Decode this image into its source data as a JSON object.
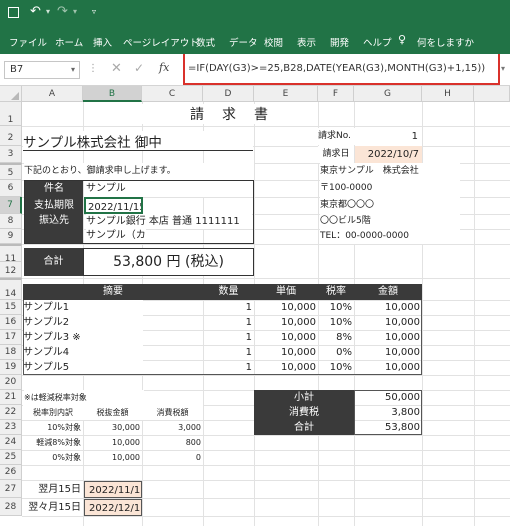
{
  "menu": [
    "ファイル",
    "ホーム",
    "挿入",
    "ページレイアウト",
    "数式",
    "データ",
    "校閲",
    "表示",
    "開発",
    "ヘルプ",
    "何をしますか"
  ],
  "formula_bar": {
    "name_box": "B7",
    "fx": "fx",
    "formula": "=IF(DAY(G3)>=25,B28,DATE(YEAR(G3),MONTH(G3)+1,15))"
  },
  "columns": [
    "A",
    "B",
    "C",
    "D",
    "E",
    "F",
    "G",
    "H"
  ],
  "rows": [
    "1",
    "2",
    "3",
    "5",
    "6",
    "7",
    "8",
    "9",
    "11",
    "12",
    "14",
    "15",
    "16",
    "17",
    "18",
    "19",
    "20",
    "21",
    "22",
    "23",
    "24",
    "25",
    "26",
    "27",
    "28"
  ],
  "sheet": {
    "title": "請　求　書",
    "client": "サンプル株式会社 御中",
    "invoice_no_label": "請求No.",
    "invoice_no": "1",
    "invoice_date_label": "請求日",
    "invoice_date": "2022/10/7",
    "intro": "下記のとおり、御請求申し上げます。",
    "issuer": [
      "東京サンプル　株式会社",
      "〒100-0000",
      "東京都〇〇〇",
      "〇〇ビル5階",
      "TEL：00-0000-0000"
    ],
    "info_labels": [
      "件名",
      "支払期限",
      "振込先"
    ],
    "info_values": [
      "サンプル",
      "2022/11/15",
      "サンプル銀行 本店 普通 1111111",
      "サンプル（カ"
    ],
    "total_label": "合計",
    "total_value": "53,800 円 (税込)",
    "table_headers": [
      "摘要",
      "数量",
      "単価",
      "税率",
      "金額"
    ],
    "items": [
      {
        "name": "サンプル1",
        "qty": "1",
        "price": "10,000",
        "rate": "10%",
        "amount": "10,000"
      },
      {
        "name": "サンプル2",
        "qty": "1",
        "price": "10,000",
        "rate": "10%",
        "amount": "10,000"
      },
      {
        "name": "サンプル3 ※",
        "qty": "1",
        "price": "10,000",
        "rate": "8%",
        "amount": "10,000"
      },
      {
        "name": "サンプル4",
        "qty": "1",
        "price": "10,000",
        "rate": "0%",
        "amount": "10,000"
      },
      {
        "name": "サンプル5",
        "qty": "1",
        "price": "10,000",
        "rate": "10%",
        "amount": "10,000"
      }
    ],
    "note": "※は軽減税率対象",
    "tax_headers": [
      "税率別内訳",
      "税抜金額",
      "消費税額"
    ],
    "tax_rows": [
      {
        "label": "10%対象",
        "base": "30,000",
        "tax": "3,000"
      },
      {
        "label": "軽減8%対象",
        "base": "10,000",
        "tax": "800"
      },
      {
        "label": "0%対象",
        "base": "10,000",
        "tax": "0"
      }
    ],
    "summary": [
      {
        "label": "小計",
        "value": "50,000"
      },
      {
        "label": "消費税",
        "value": "3,800"
      },
      {
        "label": "合計",
        "value": "53,800"
      }
    ],
    "due": [
      {
        "label": "翌月15日",
        "value": "2022/11/15"
      },
      {
        "label": "翌々月15日",
        "value": "2022/12/15"
      }
    ]
  },
  "colors": {
    "excel_green": "#217346",
    "dark_cell": "#3a3a3a",
    "peach": "#fbe5d6",
    "highlight": "#d9312b"
  }
}
